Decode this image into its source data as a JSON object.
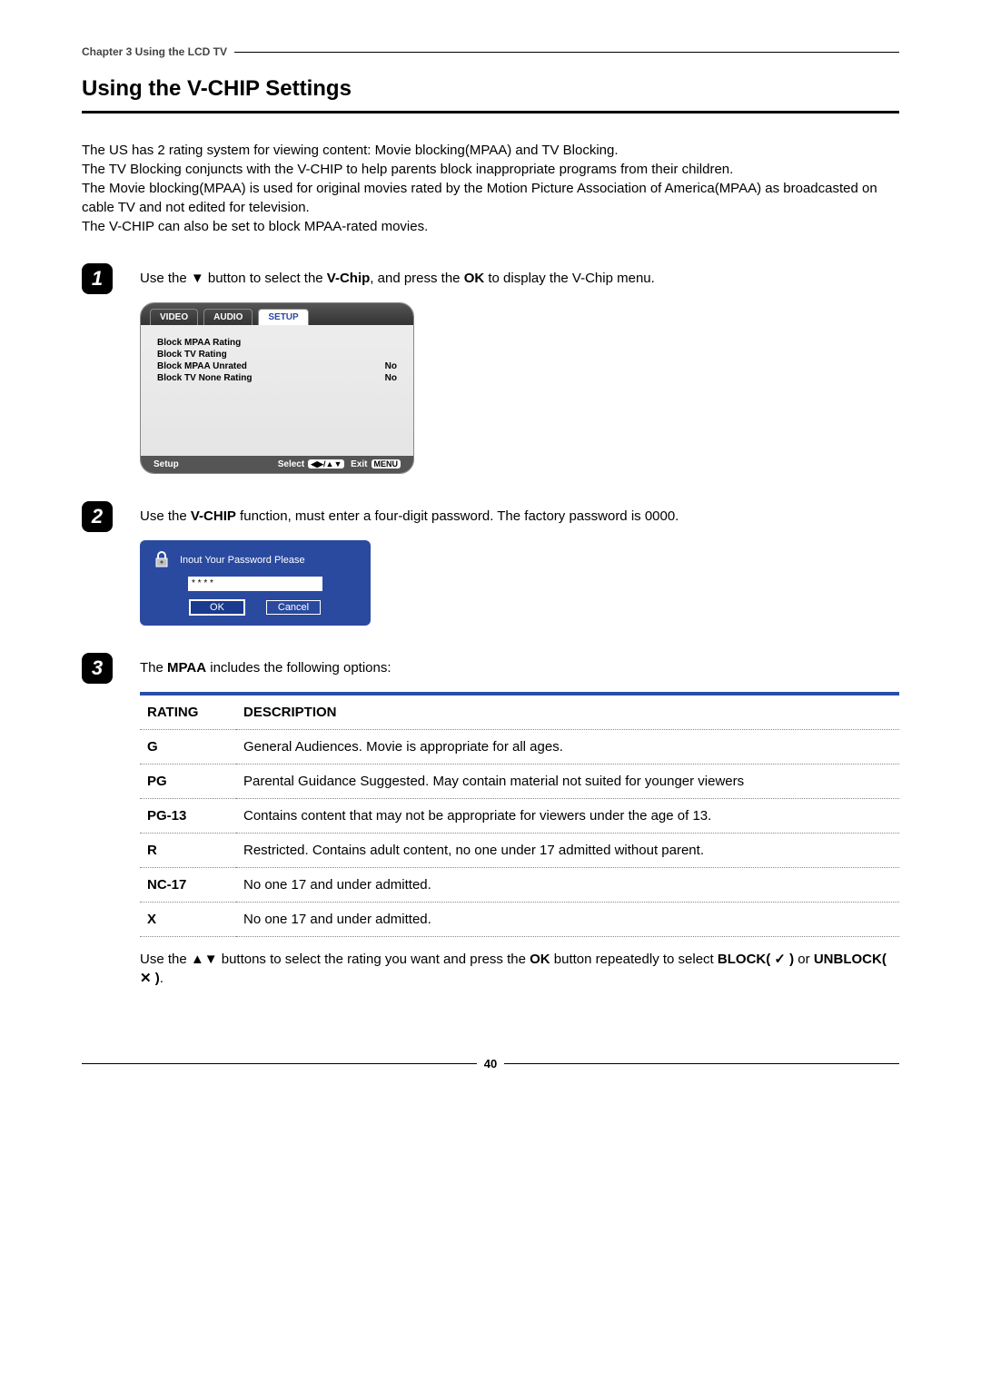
{
  "chapter_header": "Chapter 3 Using the LCD TV",
  "page_title": "Using  the V-CHIP Settings",
  "intro_lines": [
    "The US has 2 rating system for viewing content: Movie blocking(MPAA) and TV Blocking.",
    "The TV Blocking conjuncts with the V-CHIP  to help parents block inappropriate programs from their children.",
    "The Movie blocking(MPAA) is used for original movies rated by the Motion Picture Association of America(MPAA) as broadcasted on cable TV and not edited for television.",
    "The V-CHIP can also be set to block MPAA-rated movies."
  ],
  "step1": {
    "num": "1",
    "text_pre": "Use the ▼ button to select the ",
    "text_bold1": "V-Chip",
    "text_mid": ",  and press the ",
    "text_bold2": "OK",
    "text_post": " to display the V-Chip menu."
  },
  "osd": {
    "tabs": [
      "VIDEO",
      "AUDIO",
      "SETUP"
    ],
    "active_index": 2,
    "rows": [
      {
        "label": "Block MPAA Rating",
        "value": ""
      },
      {
        "label": "Block TV Rating",
        "value": ""
      },
      {
        "label": "Block MPAA Unrated",
        "value": "No"
      },
      {
        "label": "Block TV None Rating",
        "value": "No"
      }
    ],
    "footer_left": "Setup",
    "footer_select": "Select",
    "footer_arrows": "◀▶/▲▼",
    "footer_exit": "Exit",
    "footer_menu": "MENU"
  },
  "step2": {
    "num": "2",
    "text_pre": "Use the ",
    "text_bold": "V-CHIP",
    "text_post": " function, must enter a four-digit password. The factory password is 0000."
  },
  "pwd": {
    "title": "Inout Your Password Please",
    "value": "* * * *",
    "ok": "OK",
    "cancel": "Cancel"
  },
  "step3": {
    "num": "3",
    "text_pre": "The ",
    "text_bold": "MPAA",
    "text_post": " includes the following options:"
  },
  "table": {
    "headers": [
      "RATING",
      "DESCRIPTION"
    ],
    "rows": [
      {
        "r": "G",
        "d": "General Audiences.  Movie is appropriate for all ages."
      },
      {
        "r": "PG",
        "d": "Parental Guidance Suggested. May contain material not suited for younger viewers"
      },
      {
        "r": "PG-13",
        "d": "Contains content that may not be appropriate for viewers under the age of 13."
      },
      {
        "r": "R",
        "d": "Restricted. Contains adult content, no one under 17 admitted without parent."
      },
      {
        "r": "NC-17",
        "d": "No one 17 and under admitted."
      },
      {
        "r": "X",
        "d": "No one 17 and under admitted."
      }
    ]
  },
  "tail_pre": "Use the ▲▼ buttons to select the rating you want and press the ",
  "tail_bold1": "OK",
  "tail_mid": " button repeatedly to select ",
  "tail_bold2": "BLOCK( ✓ )",
  "tail_or": " or ",
  "tail_bold3": "UNBLOCK( ✕ )",
  "tail_end": ".",
  "page_number": "40"
}
